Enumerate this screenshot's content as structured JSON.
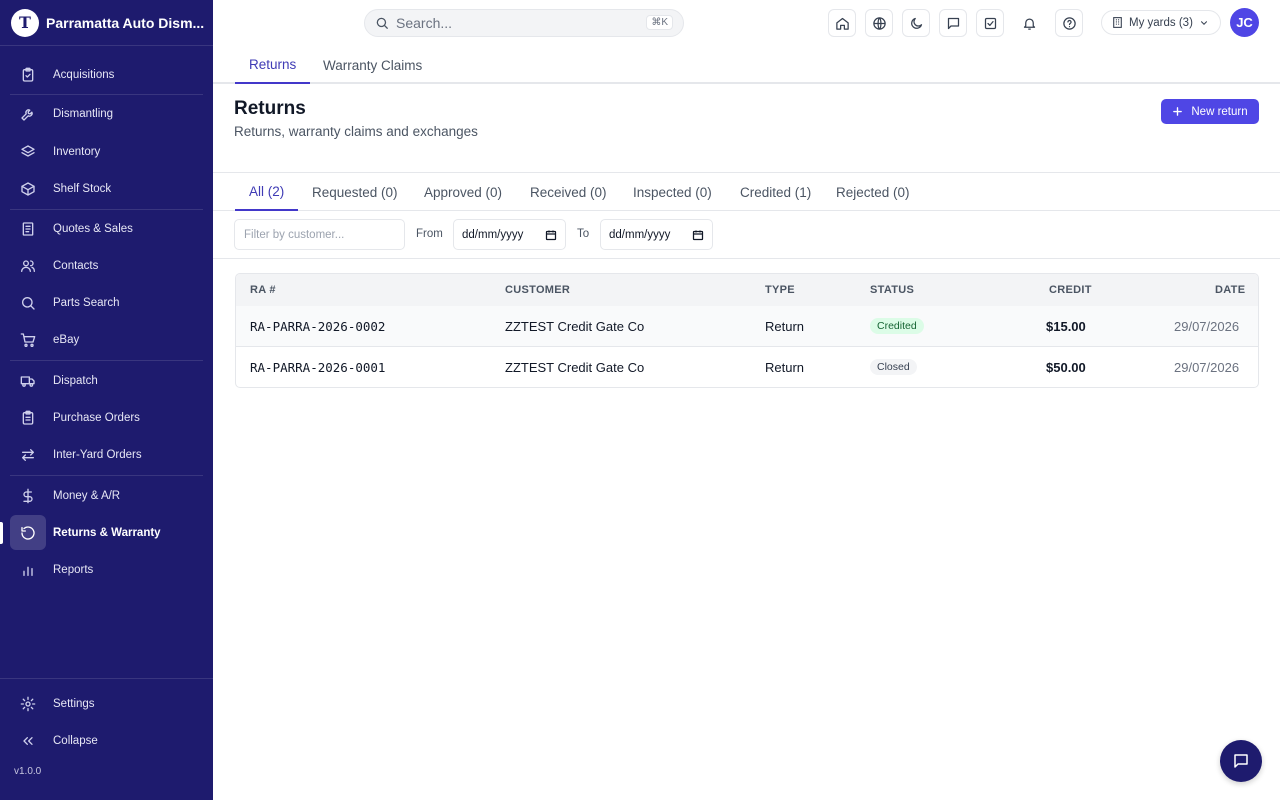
{
  "brand": {
    "name": "Parramatta Auto Dism...",
    "logo_letter": "T"
  },
  "sidebar": {
    "items": [
      {
        "label": "Acquisitions",
        "icon": "clipboard-check-icon"
      },
      {
        "label": "Dismantling",
        "icon": "wrench-icon"
      },
      {
        "label": "Inventory",
        "icon": "layers-icon"
      },
      {
        "label": "Shelf Stock",
        "icon": "box-icon"
      },
      {
        "label": "Quotes & Sales",
        "icon": "receipt-icon"
      },
      {
        "label": "Contacts",
        "icon": "users-icon"
      },
      {
        "label": "Parts Search",
        "icon": "search-icon"
      },
      {
        "label": "eBay",
        "icon": "cart-icon"
      },
      {
        "label": "Dispatch",
        "icon": "truck-icon"
      },
      {
        "label": "Purchase Orders",
        "icon": "clipboard-list-icon"
      },
      {
        "label": "Inter-Yard Orders",
        "icon": "arrows-left-right-icon"
      },
      {
        "label": "Money & A/R",
        "icon": "dollar-icon"
      },
      {
        "label": "Returns & Warranty",
        "icon": "rotate-ccw-icon",
        "active": true
      },
      {
        "label": "Reports",
        "icon": "bar-chart-icon"
      }
    ],
    "settings": "Settings",
    "collapse": "Collapse",
    "version": "v1.0.0"
  },
  "topbar": {
    "search_placeholder": "Search...",
    "shortcut": "⌘K",
    "yards": "My yards (3)",
    "avatar": "JC"
  },
  "subtabs": [
    "Returns",
    "Warranty Claims"
  ],
  "page": {
    "title": "Returns",
    "subtitle": "Returns, warranty claims and exchanges",
    "new_button": "New return"
  },
  "status_tabs": [
    "All (2)",
    "Requested (0)",
    "Approved (0)",
    "Received (0)",
    "Inspected (0)",
    "Credited (1)",
    "Rejected (0)"
  ],
  "filters": {
    "customer_placeholder": "Filter by customer...",
    "from_label": "From",
    "to_label": "To",
    "from_value": "dd/mm/yyyy",
    "to_value": "dd/mm/yyyy"
  },
  "table": {
    "headers": {
      "ra": "RA #",
      "customer": "CUSTOMER",
      "type": "TYPE",
      "status": "STATUS",
      "credit": "CREDIT",
      "date": "DATE"
    },
    "rows": [
      {
        "ra": "RA-PARRA-2026-0002",
        "customer": "ZZTEST Credit Gate Co",
        "type": "Return",
        "status": "Credited",
        "credit": "$15.00",
        "date": "29/07/2026"
      },
      {
        "ra": "RA-PARRA-2026-0001",
        "customer": "ZZTEST Credit Gate Co",
        "type": "Return",
        "status": "Closed",
        "credit": "$50.00",
        "date": "29/07/2026"
      }
    ]
  },
  "colors": {
    "sidebar_bg": "#1e1b6e",
    "accent": "#4f46e5",
    "credited_bg": "#dcfce7",
    "credited_text": "#166534"
  }
}
